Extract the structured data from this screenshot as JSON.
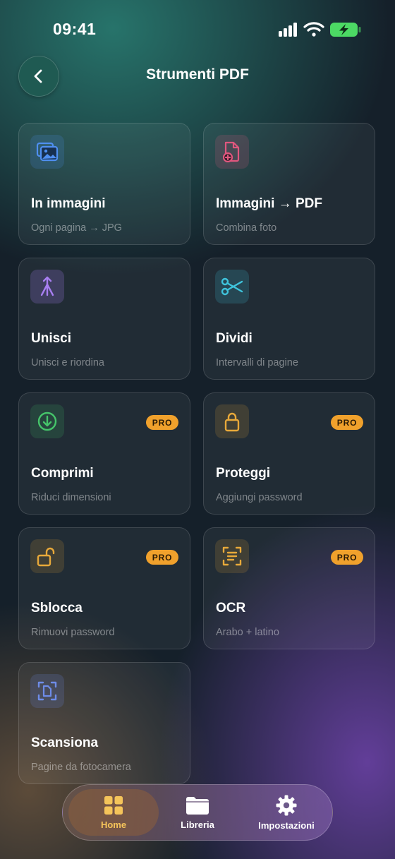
{
  "status_bar": {
    "time": "09:41",
    "battery_color": "#4cd964"
  },
  "header": {
    "title": "Strumenti PDF",
    "back_icon": "chevron-left-icon"
  },
  "tools": [
    {
      "title": "In immagini",
      "subtitle": "Ogni pagina → JPG",
      "icon": "images-icon",
      "pro": false
    },
    {
      "title": "Immagini → PDF",
      "subtitle": "Combina foto",
      "icon": "file-plus-icon",
      "pro": false
    },
    {
      "title": "Unisci",
      "subtitle": "Unisci e riordina",
      "icon": "merge-icon",
      "pro": false
    },
    {
      "title": "Dividi",
      "subtitle": "Intervalli di pagine",
      "icon": "scissors-icon",
      "pro": false
    },
    {
      "title": "Comprimi",
      "subtitle": "Riduci dimensioni",
      "icon": "download-circle-icon",
      "pro": true
    },
    {
      "title": "Proteggi",
      "subtitle": "Aggiungi password",
      "icon": "lock-icon",
      "pro": true
    },
    {
      "title": "Sblocca",
      "subtitle": "Rimuovi password",
      "icon": "unlock-icon",
      "pro": true
    },
    {
      "title": "OCR",
      "subtitle": "Arabo + latino",
      "icon": "text-scan-icon",
      "pro": true
    },
    {
      "title": "Scansiona",
      "subtitle": "Pagine da fotocamera",
      "icon": "document-scan-icon",
      "pro": false
    }
  ],
  "pro_badge_label": "PRO",
  "colors": {
    "accent_pro": "#f0a12c",
    "images": "#4f8ff0",
    "file_plus": "#e0577e",
    "merge": "#a77ef0",
    "scissors": "#3fc4dc",
    "compress": "#45c46a",
    "lock": "#e8a93a",
    "scan": "#6e8ce8"
  },
  "tabbar": {
    "items": [
      {
        "label": "Home",
        "icon": "grid-icon",
        "active": true
      },
      {
        "label": "Libreria",
        "icon": "folder-icon",
        "active": false
      },
      {
        "label": "Impostazioni",
        "icon": "gear-icon",
        "active": false
      }
    ]
  }
}
